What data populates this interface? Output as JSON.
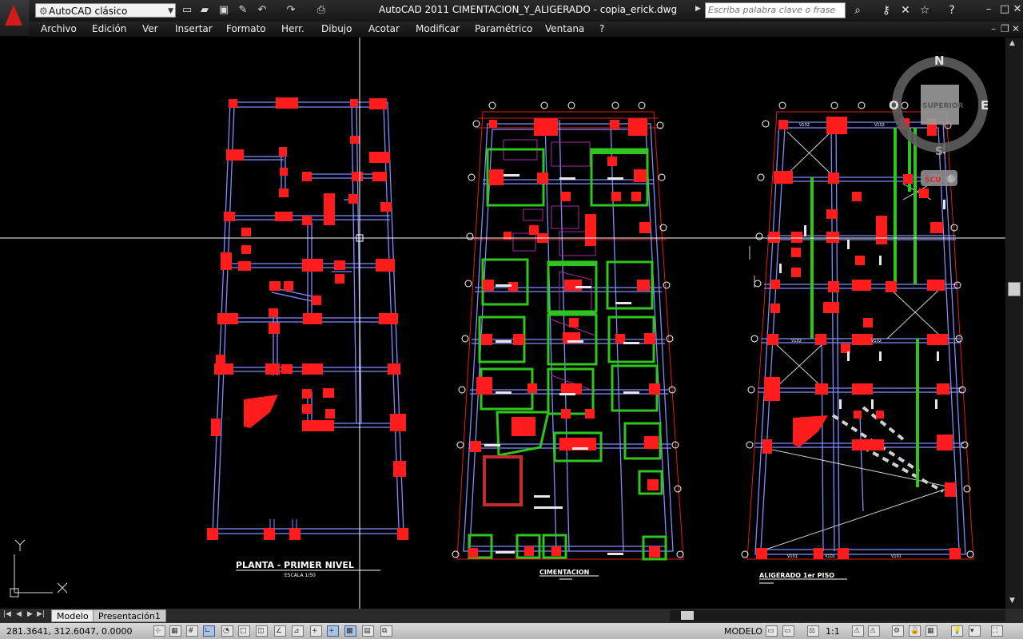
{
  "titlebar": {
    "workspace": "AutoCAD clásico",
    "title": "AutoCAD 2011    CIMENTACION_Y_ALIGERADO - copia_erick.dwg",
    "search_placeholder": "Escriba palabra clave o frase",
    "help": "?"
  },
  "menu": {
    "items": [
      "Archivo",
      "Edición",
      "Ver",
      "Insertar",
      "Formato",
      "Herr.",
      "Dibujo",
      "Acotar",
      "Modificar",
      "Paramétrico",
      "Ventana",
      "?"
    ]
  },
  "drawing": {
    "plan1_title": "PLANTA - PRIMER NIVEL",
    "plan1_scale": "ESCALA 1/50",
    "plan2_title": "CIMENTACION",
    "plan3_title": "ALIGERADO 1er PISO",
    "viga_labels": [
      "V102",
      "V102",
      "V102",
      "V102",
      "V101",
      "V101",
      "V101"
    ]
  },
  "viewcube": {
    "north": "N",
    "south": "S",
    "east": "E",
    "west": "O",
    "face": "SUPERIOR",
    "ucs": "SCU"
  },
  "ucs_icon": {
    "x_label": "X",
    "y_label": "Y"
  },
  "layout_tabs": {
    "model": "Modelo",
    "layout1": "Presentación1"
  },
  "status": {
    "coordinates": "281.3641, 312.6047, 0.0000",
    "space": "MODELO",
    "annotation_scale": "1:1"
  },
  "colors": {
    "cad_red": "#ff0000",
    "cad_green": "#28c21e",
    "cad_blue": "#6b7cff",
    "cad_white": "#ffffff",
    "cad_magenta": "#b020b0",
    "background": "#000000"
  }
}
